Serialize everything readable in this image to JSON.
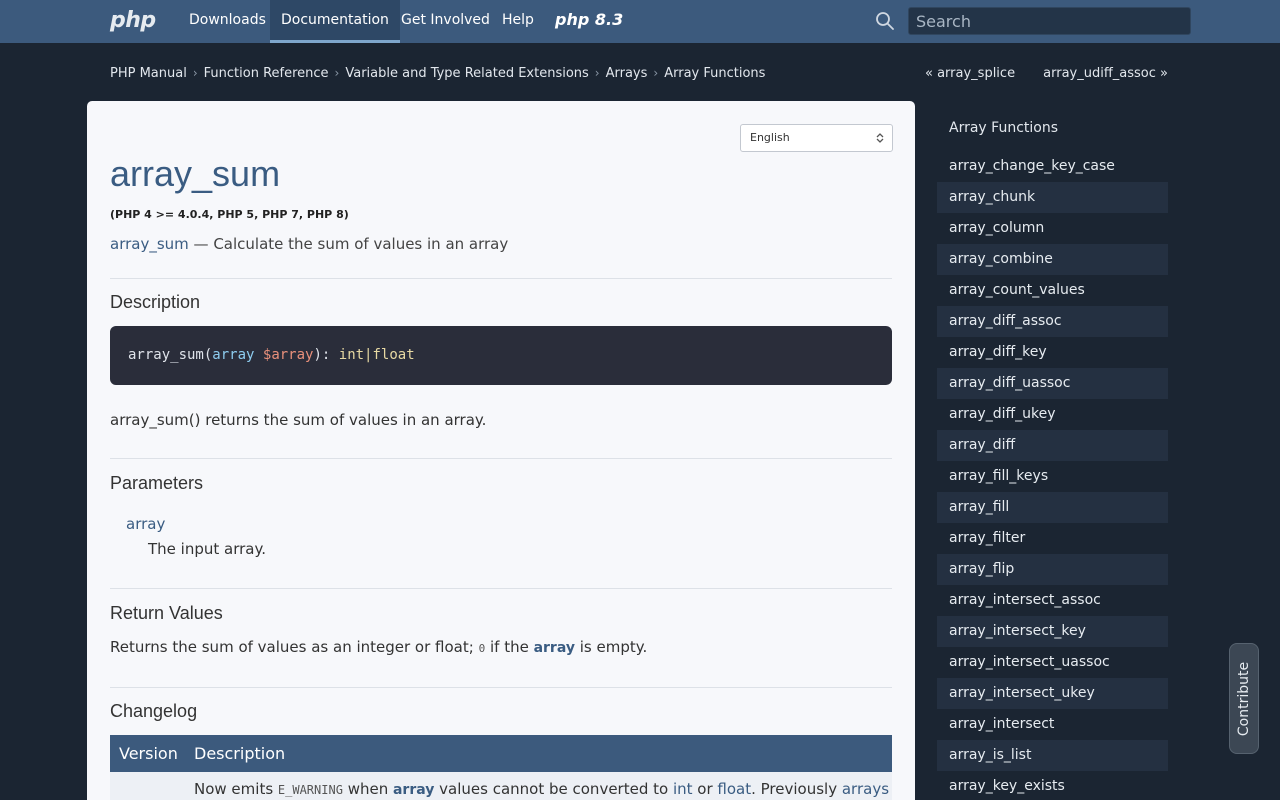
{
  "nav": {
    "logo": "php",
    "links": [
      "Downloads",
      "Documentation",
      "Get Involved",
      "Help"
    ],
    "version_badge": "php 8.3",
    "search_placeholder": "Search"
  },
  "breadcrumb": [
    "PHP Manual",
    "Function Reference",
    "Variable and Type Related Extensions",
    "Arrays",
    "Array Functions"
  ],
  "pager": {
    "prev": "« array_splice",
    "next": "array_udiff_assoc »"
  },
  "language": "English",
  "page": {
    "title": "array_sum",
    "versions": "(PHP 4 >= 4.0.4, PHP 5, PHP 7, PHP 8)",
    "refname": "array_sum",
    "refpurpose": "— Calculate the sum of values in an array",
    "description_heading": "Description",
    "signature": {
      "fn": "array_sum(",
      "type": "array",
      "var": "$array",
      "close": "): ",
      "ret": "int|float"
    },
    "description_text": "array_sum() returns the sum of values in an array.",
    "parameters_heading": "Parameters",
    "param_name": "array",
    "param_desc": "The input array.",
    "return_heading": "Return Values",
    "return_text_1": "Returns the sum of values as an integer or float; ",
    "return_code": "0",
    "return_text_2": " if the ",
    "return_param": "array",
    "return_text_3": " is empty.",
    "changelog_heading": "Changelog",
    "changelog_headers": [
      "Version",
      "Description"
    ],
    "changelog_row": {
      "t1": "Now emits ",
      "code": "E_WARNING",
      "t2": " when ",
      "p1": "array",
      "t3": " values cannot be converted to ",
      "l1": "int",
      "t4": " or ",
      "l2": "float",
      "t5": ". Previously ",
      "l3": "arrays"
    }
  },
  "sidebar": {
    "title": "Array Functions",
    "items": [
      "array_change_key_case",
      "array_chunk",
      "array_column",
      "array_combine",
      "array_count_values",
      "array_diff_assoc",
      "array_diff_key",
      "array_diff_uassoc",
      "array_diff_ukey",
      "array_diff",
      "array_fill_keys",
      "array_fill",
      "array_filter",
      "array_flip",
      "array_intersect_assoc",
      "array_intersect_key",
      "array_intersect_uassoc",
      "array_intersect_ukey",
      "array_intersect",
      "array_is_list",
      "array_key_exists"
    ]
  },
  "contribute_label": "Contribute"
}
